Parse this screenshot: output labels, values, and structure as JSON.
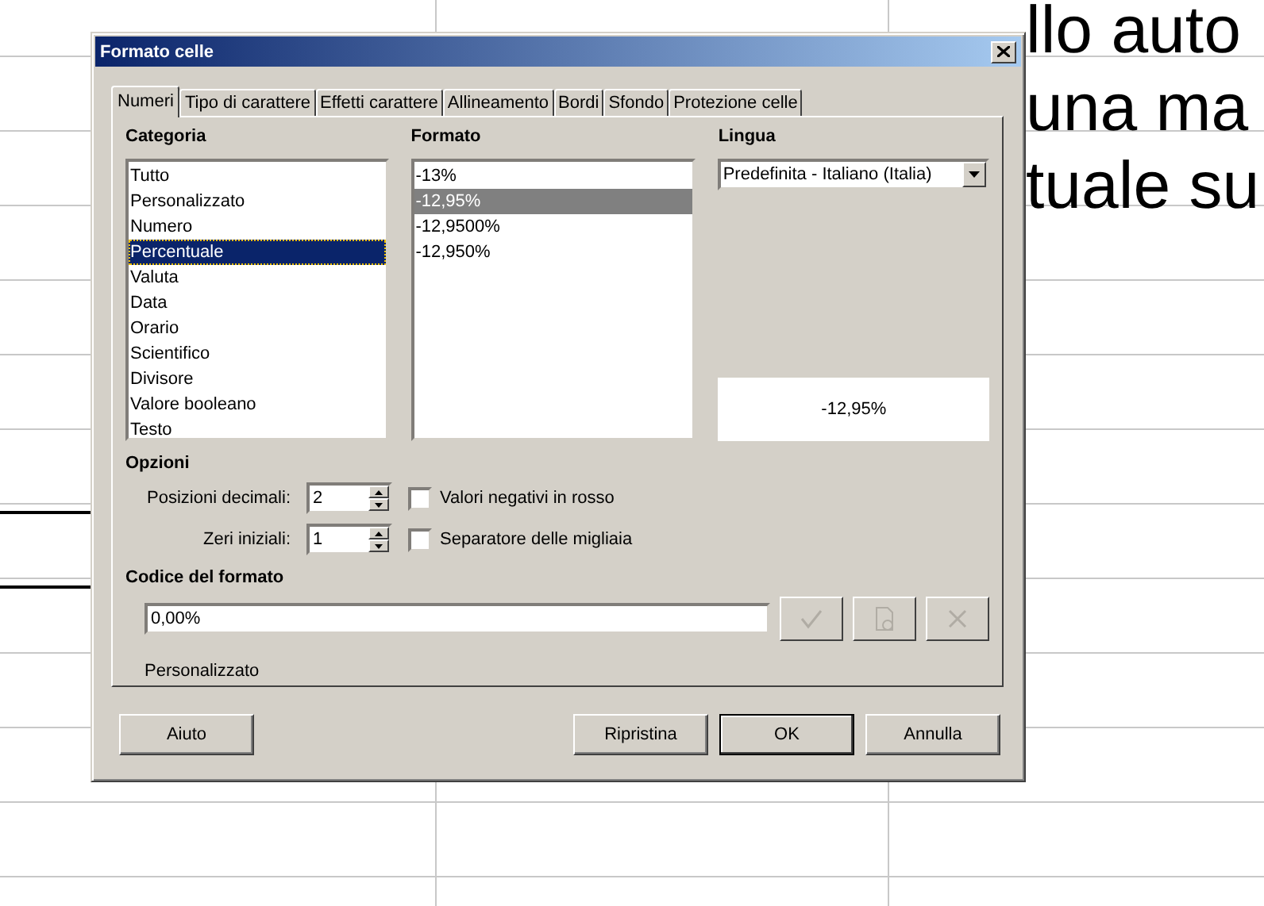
{
  "background": {
    "text_lines": [
      "llo auto",
      "una ma",
      "tuale su"
    ]
  },
  "window": {
    "title": "Formato celle"
  },
  "tabs": [
    {
      "label": "Numeri",
      "selected": true
    },
    {
      "label": "Tipo di carattere",
      "selected": false
    },
    {
      "label": "Effetti carattere",
      "selected": false
    },
    {
      "label": "Allineamento",
      "selected": false
    },
    {
      "label": "Bordi",
      "selected": false
    },
    {
      "label": "Sfondo",
      "selected": false
    },
    {
      "label": "Protezione celle",
      "selected": false
    }
  ],
  "category": {
    "label": "Categoria",
    "focused": true,
    "items": [
      {
        "label": "Tutto",
        "selected": false
      },
      {
        "label": "Personalizzato",
        "selected": false
      },
      {
        "label": "Numero",
        "selected": false
      },
      {
        "label": "Percentuale",
        "selected": true
      },
      {
        "label": "Valuta",
        "selected": false
      },
      {
        "label": "Data",
        "selected": false
      },
      {
        "label": "Orario",
        "selected": false
      },
      {
        "label": "Scientifico",
        "selected": false
      },
      {
        "label": "Divisore",
        "selected": false
      },
      {
        "label": "Valore booleano",
        "selected": false
      },
      {
        "label": "Testo",
        "selected": false
      }
    ]
  },
  "format": {
    "label": "Formato",
    "focused": false,
    "items": [
      {
        "label": "-13%",
        "selected": false
      },
      {
        "label": "-12,95%",
        "selected": true
      },
      {
        "label": "-12,9500%",
        "selected": false
      },
      {
        "label": "-12,950%",
        "selected": false
      }
    ]
  },
  "language": {
    "label": "Lingua",
    "value": "Predefinita - Italiano (Italia)"
  },
  "preview": "-12,95%",
  "options": {
    "label": "Opzioni",
    "spinners": [
      {
        "label": "Posizioni decimali:",
        "value": "2"
      },
      {
        "label": "Zeri iniziali:",
        "value": "1"
      }
    ],
    "checkboxes": [
      {
        "label": "Valori negativi in rosso",
        "checked": false
      },
      {
        "label": "Separatore delle migliaia",
        "checked": false
      }
    ]
  },
  "format_code": {
    "label": "Codice del formato",
    "value": "0,00%",
    "comment": "Personalizzato",
    "tools": [
      {
        "kind": "apply",
        "disabled": true
      },
      {
        "kind": "edit",
        "disabled": true
      },
      {
        "kind": "delete",
        "disabled": true
      }
    ]
  },
  "buttons": [
    {
      "label": "Aiuto",
      "default": false
    },
    {
      "label": "Ripristina",
      "default": false
    },
    {
      "label": "OK",
      "default": true
    },
    {
      "label": "Annulla",
      "default": false
    }
  ]
}
